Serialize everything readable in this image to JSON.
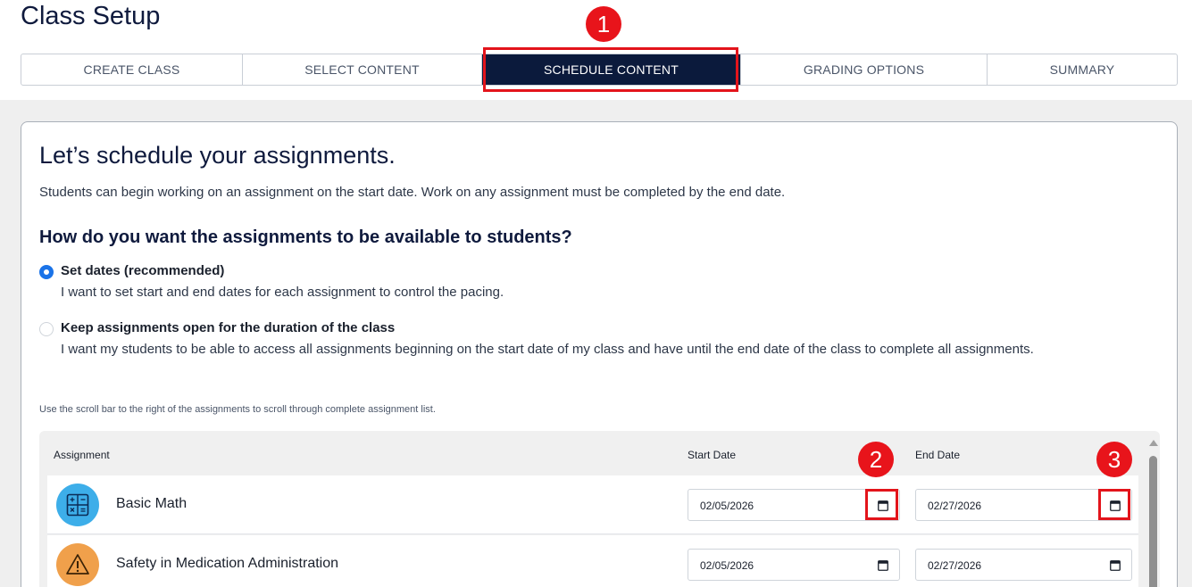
{
  "page": {
    "title": "Class Setup"
  },
  "steps": [
    {
      "label": "CREATE CLASS",
      "active": false
    },
    {
      "label": "SELECT CONTENT",
      "active": false
    },
    {
      "label": "SCHEDULE CONTENT",
      "active": true
    },
    {
      "label": "GRADING OPTIONS",
      "active": false
    },
    {
      "label": "SUMMARY",
      "active": false
    }
  ],
  "callouts": [
    "1",
    "2",
    "3"
  ],
  "card": {
    "heading": "Let’s schedule your assignments.",
    "intro": "Students can begin working on an assignment on the start date. Work on any assignment must be completed by the end date.",
    "question": "How do you want the assignments to be available to students?",
    "options": [
      {
        "label": "Set dates (recommended)",
        "description": "I want to set start and end dates for each assignment to control the pacing.",
        "selected": true
      },
      {
        "label": "Keep assignments open for the duration of the class",
        "description": "I want my students to be able to access all assignments beginning on the start date of my class and have until the end date of the class to complete all assignments.",
        "selected": false
      }
    ],
    "hint": "Use the scroll bar to the right of the assignments to scroll through complete assignment list."
  },
  "table": {
    "headers": {
      "assignment": "Assignment",
      "start": "Start Date",
      "end": "End Date"
    },
    "rows": [
      {
        "name": "Basic Math",
        "start": "02/05/2026",
        "end": "02/27/2026",
        "icon": "calculator-icon",
        "icon_color": "#3daee9"
      },
      {
        "name": "Safety in Medication Administration",
        "start": "02/05/2026",
        "end": "02/27/2026",
        "icon": "warning-icon",
        "icon_color": "#f0a04b"
      }
    ]
  },
  "colors": {
    "navy": "#0b1a3c",
    "accent_blue": "#1a73e8",
    "highlight_red": "#e3141b"
  }
}
